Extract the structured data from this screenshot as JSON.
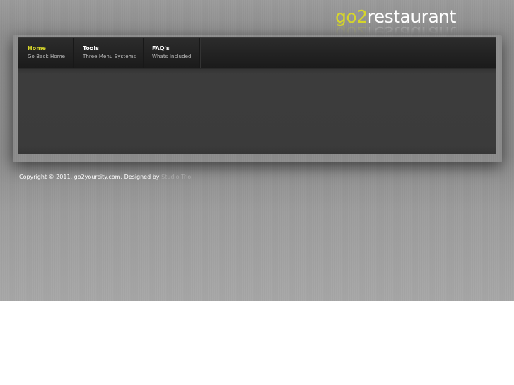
{
  "logo": {
    "part1": "go2",
    "part2": "restaurant"
  },
  "nav": {
    "items": [
      {
        "title": "Home",
        "subtitle": "Go Back Home",
        "active": true
      },
      {
        "title": "Tools",
        "subtitle": "Three Menu Systems",
        "active": false
      },
      {
        "title": "FAQ's",
        "subtitle": "Whats Included",
        "active": false
      }
    ]
  },
  "footer": {
    "copyright": "Copyright © 2011. go2yourcity.com. Designed by",
    "designer": "Studio Trio"
  },
  "colors": {
    "accent": "#d6d62a",
    "nav_bg": "#222222",
    "panel_bg": "#3b3b3b",
    "page_bg": "#8c8c8c"
  }
}
